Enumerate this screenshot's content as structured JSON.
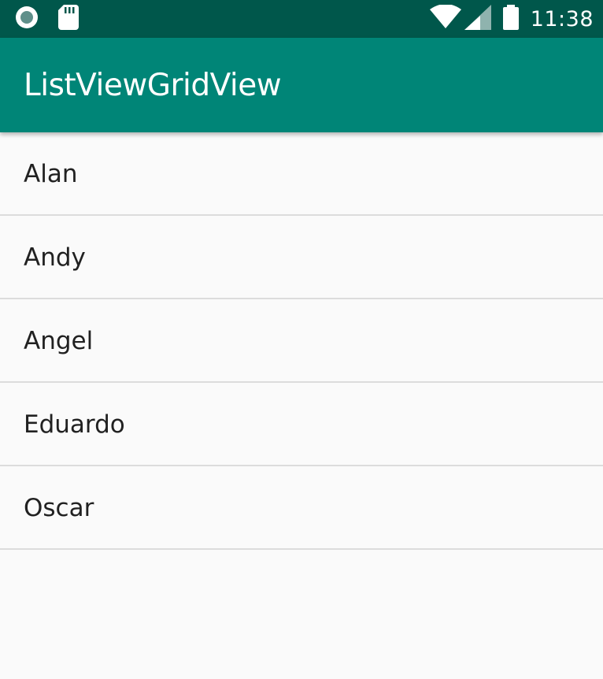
{
  "status_bar": {
    "time": "11:38",
    "background_color": "#00574b",
    "left_icons": [
      "record-icon",
      "sd-card-icon"
    ],
    "right_icons": [
      "wifi-icon",
      "cell-signal-icon",
      "battery-icon"
    ]
  },
  "app_bar": {
    "title": "ListViewGridView",
    "background_color": "#008577"
  },
  "list": {
    "items": [
      {
        "label": "Alan"
      },
      {
        "label": "Andy"
      },
      {
        "label": "Angel"
      },
      {
        "label": "Eduardo"
      },
      {
        "label": "Oscar"
      }
    ]
  }
}
